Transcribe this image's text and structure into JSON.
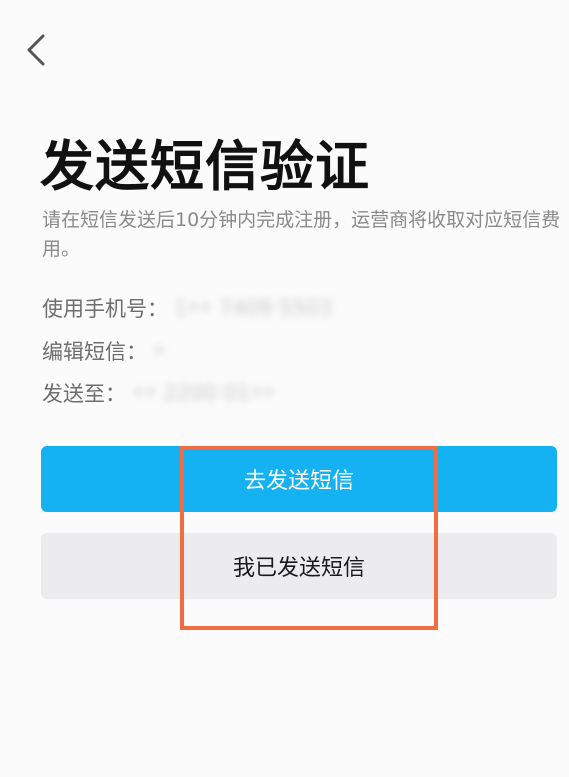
{
  "header": {
    "back_icon": "chevron-left-icon"
  },
  "title": "发送短信验证",
  "description": "请在短信发送后10分钟内完成注册，运营商将收取对应短信费用。",
  "info": {
    "phone_label": "使用手机号：",
    "phone_value": "1•• 7409 5503",
    "sms_label": "编辑短信：",
    "sms_value": "•",
    "send_label": "发送至：",
    "send_value": "•• 2200 01••"
  },
  "buttons": {
    "send_sms": "去发送短信",
    "sms_sent": "我已发送短信"
  },
  "colors": {
    "primary": "#14b2f2",
    "secondary_button": "#ececee",
    "highlight": "#f06d44",
    "description_text": "#8a8a8a"
  }
}
